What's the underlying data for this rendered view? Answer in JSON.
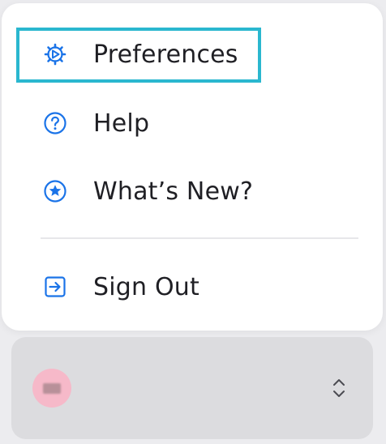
{
  "menu": {
    "items": [
      {
        "label": "Preferences",
        "icon": "gear-icon"
      },
      {
        "label": "Help",
        "icon": "question-circle-icon"
      },
      {
        "label": "What’s New?",
        "icon": "star-circle-icon"
      },
      {
        "label": "Sign Out",
        "icon": "sign-out-icon"
      }
    ]
  },
  "account": {
    "name": "",
    "subtitle": "",
    "switcher_icon": "chevron-up-down-icon"
  },
  "colors": {
    "accent": "#1a73e8",
    "highlight": "#2ab7cf",
    "avatar": "#f6b9c9"
  }
}
